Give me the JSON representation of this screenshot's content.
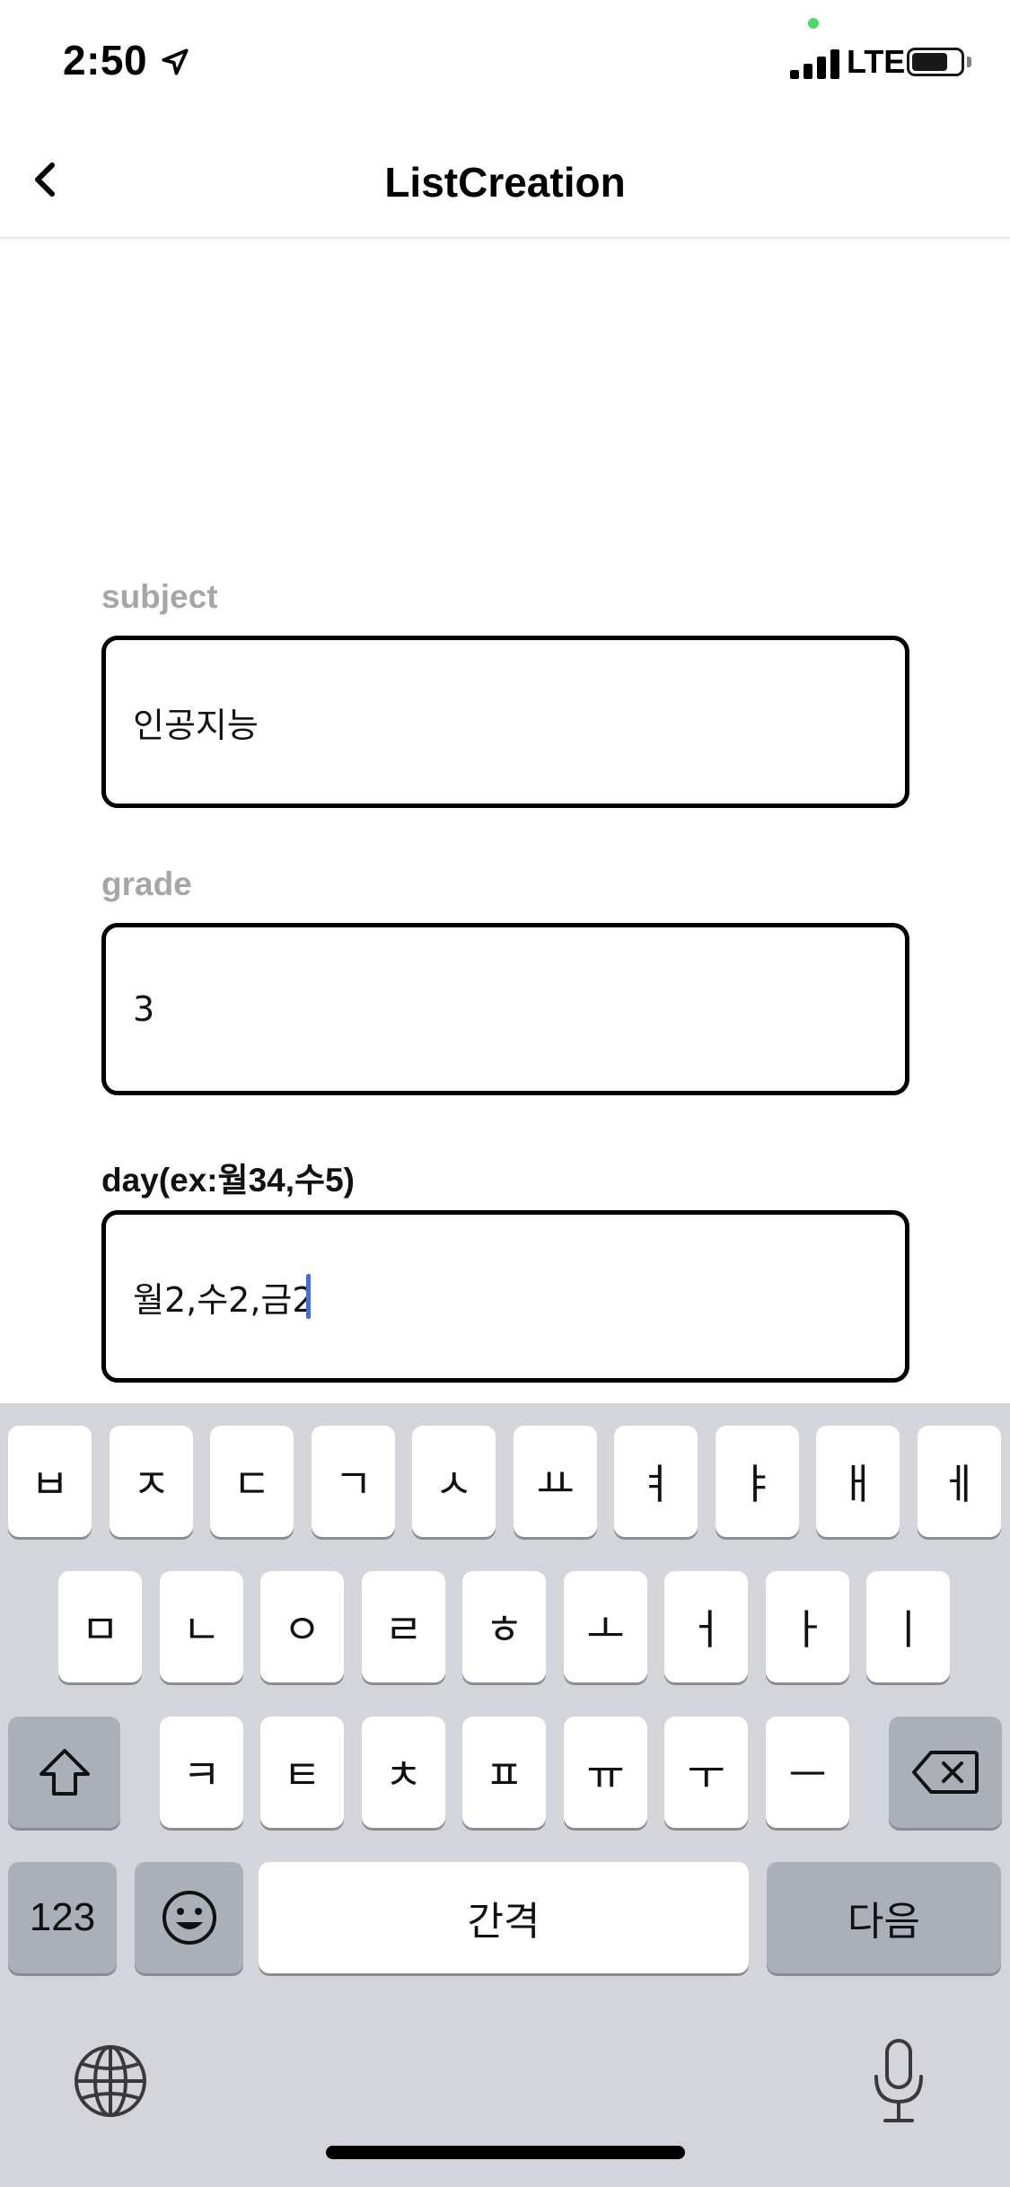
{
  "status_bar": {
    "time": "2:50",
    "network": "LTE",
    "signal_bars": 4,
    "battery_level": 0.75
  },
  "nav": {
    "title": "ListCreation"
  },
  "form": {
    "subject": {
      "label": "subject",
      "value": "인공지능"
    },
    "grade": {
      "label": "grade",
      "value": "3"
    },
    "day": {
      "label": "day(ex:월34,수5)",
      "value": "월2,수2,금2"
    }
  },
  "keyboard": {
    "row1": [
      "ㅂ",
      "ㅈ",
      "ㄷ",
      "ㄱ",
      "ㅅ",
      "ㅛ",
      "ㅕ",
      "ㅑ",
      "ㅐ",
      "ㅔ"
    ],
    "row2": [
      "ㅁ",
      "ㄴ",
      "ㅇ",
      "ㄹ",
      "ㅎ",
      "ㅗ",
      "ㅓ",
      "ㅏ",
      "ㅣ"
    ],
    "row3": [
      "ㅋ",
      "ㅌ",
      "ㅊ",
      "ㅍ",
      "ㅠ",
      "ㅜ",
      "ㅡ"
    ],
    "numbers_label": "123",
    "space_label": "간격",
    "return_label": "다음"
  },
  "icons": [
    "location-arrow-icon",
    "back-chevron-icon",
    "shift-icon",
    "delete-icon",
    "emoji-icon",
    "globe-icon",
    "microphone-icon"
  ]
}
